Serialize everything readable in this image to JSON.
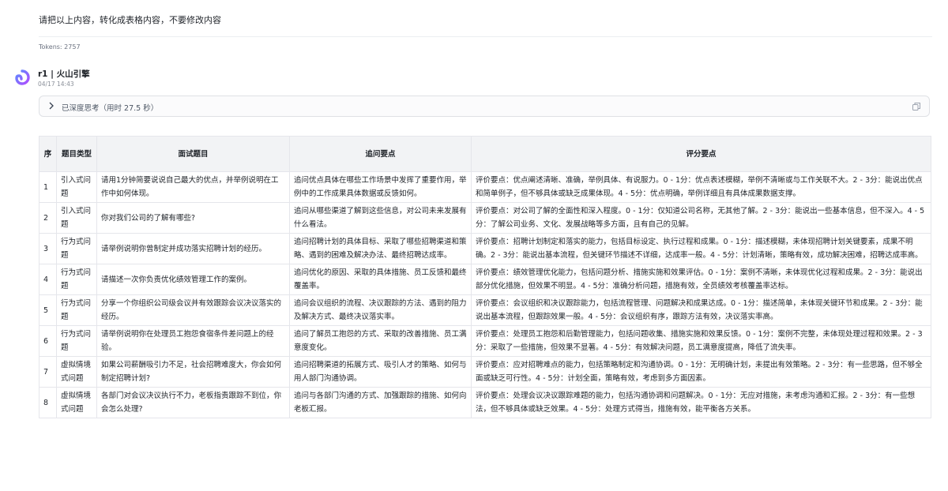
{
  "user_message": "请把以上内容，转化成表格内容，不要修改内容",
  "tokens": "Tokens: 2757",
  "bot": {
    "name": "r1 | 火山引擎",
    "time": "04/17 14:43"
  },
  "thinking": {
    "label": "已深度思考（用时 27.5 秒）"
  },
  "colors": {
    "accent": "#7b5cff",
    "header_bg": "#f2f3f5",
    "border": "#e5e6eb"
  },
  "table": {
    "headers": [
      "序",
      "题目类型",
      "面试题目",
      "追问要点",
      "评分要点"
    ],
    "rows": [
      [
        "1",
        "引入式问题",
        "请用1分钟简要说说自己最大的优点，并举例说明在工作中如何体现。",
        "追问优点具体在哪些工作场景中发挥了重要作用，举例中的工作成果具体数据或反馈如何。",
        "评价要点：优点阐述清晰、准确，举例具体、有说服力。0 - 1分：优点表述模糊，举例不清晰或与工作关联不大。2 - 3分：能说出优点和简单例子，但不够具体或缺乏成果体现。4 - 5分：优点明确，举例详细且有具体成果数据支撑。"
      ],
      [
        "2",
        "引入式问题",
        "你对我们公司的了解有哪些?",
        "追问从哪些渠道了解到这些信息，对公司未来发展有什么看法。",
        "评价要点：对公司了解的全面性和深入程度。0 - 1分：仅知道公司名称，无其他了解。2 - 3分：能说出一些基本信息，但不深入。4 - 5分：了解公司业务、文化、发展战略等多方面，且有自己的见解。"
      ],
      [
        "3",
        "行为式问题",
        "请举例说明你曾制定并成功落实招聘计划的经历。",
        "追问招聘计划的具体目标、采取了哪些招聘渠道和策略、遇到的困难及解决办法、最终招聘达成率。",
        "评价要点：招聘计划制定和落实的能力，包括目标设定、执行过程和成果。0 - 1分：描述模糊，未体现招聘计划关键要素，成果不明确。2 - 3分：能说出基本流程，但关键环节描述不详细，达成率一般。4 - 5分：计划清晰，策略有效，成功解决困难，招聘达成率高。"
      ],
      [
        "4",
        "行为式问题",
        "请描述一次你负责优化绩效管理工作的案例。",
        "追问优化的原因、采取的具体措施、员工反馈和最终覆盖率。",
        "评价要点：绩效管理优化能力，包括问题分析、措施实施和效果评估。0 - 1分：案例不清晰，未体现优化过程和成果。2 - 3分：能说出部分优化措施，但效果不明显。4 - 5分：准确分析问题，措施有效，全员绩效考核覆盖率达标。"
      ],
      [
        "5",
        "行为式问题",
        "分享一个你组织公司级会议并有效跟踪会议决议落实的经历。",
        "追问会议组织的流程、决议跟踪的方法、遇到的阻力及解决方式、最终决议落实率。",
        "评价要点：会议组织和决议跟踪能力，包括流程管理、问题解决和成果达成。0 - 1分：描述简单，未体现关键环节和成果。2 - 3分：能说出基本流程，但跟踪效果一般。4 - 5分：会议组织有序，跟踪方法有效，决议落实率高。"
      ],
      [
        "6",
        "行为式问题",
        "请举例说明你在处理员工抱怨食宿条件差问题上的经验。",
        "追问了解员工抱怨的方式、采取的改善措施、员工满意度变化。",
        "评价要点：处理员工抱怨和后勤管理能力，包括问题收集、措施实施和效果反馈。0 - 1分：案例不完整，未体现处理过程和效果。2 - 3分：采取了一些措施，但效果不显著。4 - 5分：有效解决问题，员工满意度提高，降低了流失率。"
      ],
      [
        "7",
        "虚拟情境式问题",
        "如果公司薪酬吸引力不足，社会招聘难度大，你会如何制定招聘计划?",
        "追问招聘渠道的拓展方式、吸引人才的策略、如何与用人部门沟通协调。",
        "评价要点：应对招聘难点的能力，包括策略制定和沟通协调。0 - 1分：无明确计划，未提出有效策略。2 - 3分：有一些思路，但不够全面或缺乏可行性。4 - 5分：计划全面，策略有效，考虑到多方面因素。"
      ],
      [
        "8",
        "虚拟情境式问题",
        "各部门对会议决议执行不力，老板指责跟踪不到位，你会怎么处理?",
        "追问与各部门沟通的方式、加强跟踪的措施、如何向老板汇报。",
        "评价要点：处理会议决议跟踪难题的能力，包括沟通协调和问题解决。0 - 1分：无应对措施，未考虑沟通和汇报。2 - 3分：有一些想法，但不够具体或缺乏效果。4 - 5分：处理方式得当，措施有效，能平衡各方关系。"
      ]
    ]
  }
}
